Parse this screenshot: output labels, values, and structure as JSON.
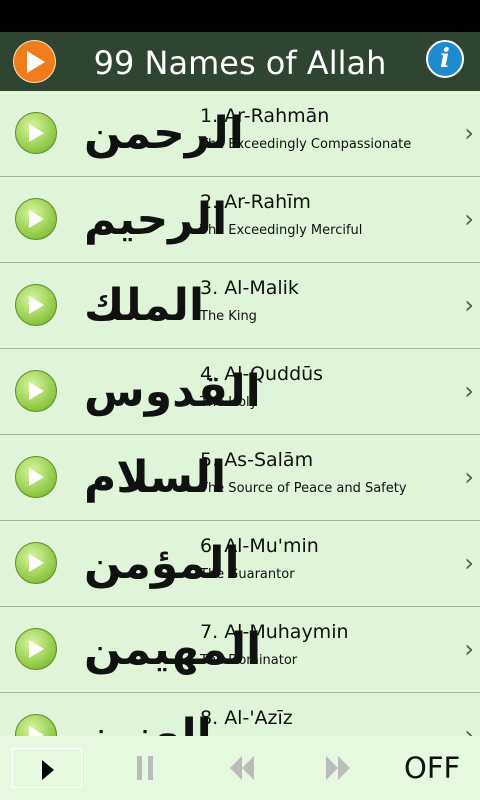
{
  "header": {
    "title": "99 Names of Allah"
  },
  "names": [
    {
      "number": "1.",
      "name": "Ar-Rahmān",
      "meaning": "The Exceedingly Compassionate",
      "arabic": "الرحمن"
    },
    {
      "number": "2.",
      "name": "Ar-Rahīm",
      "meaning": "The Exceedingly Merciful",
      "arabic": "الرحيم"
    },
    {
      "number": "3.",
      "name": "Al-Malik",
      "meaning": "The King",
      "arabic": "الملك"
    },
    {
      "number": "4.",
      "name": "Al-Quddūs",
      "meaning": "The Holy",
      "arabic": "القدوس"
    },
    {
      "number": "5.",
      "name": "As-Salām",
      "meaning": "The Source of Peace and Safety",
      "arabic": "السلام"
    },
    {
      "number": "6.",
      "name": "Al-Mu'min",
      "meaning": "The Guarantor",
      "arabic": "المؤمن"
    },
    {
      "number": "7.",
      "name": "Al-Muhaymin",
      "meaning": "The Dominator",
      "arabic": "المهيمن"
    },
    {
      "number": "8.",
      "name": "Al-'Azīz",
      "meaning": "",
      "arabic": "العزيز"
    }
  ],
  "bottom_bar": {
    "off_label": "OFF"
  },
  "colors": {
    "header_bg": "#2f4531",
    "list_bg": "#dff4d8",
    "play_orange": "#f07d1c",
    "info_blue": "#1e8bd1",
    "play_green": "#8ac63f"
  }
}
